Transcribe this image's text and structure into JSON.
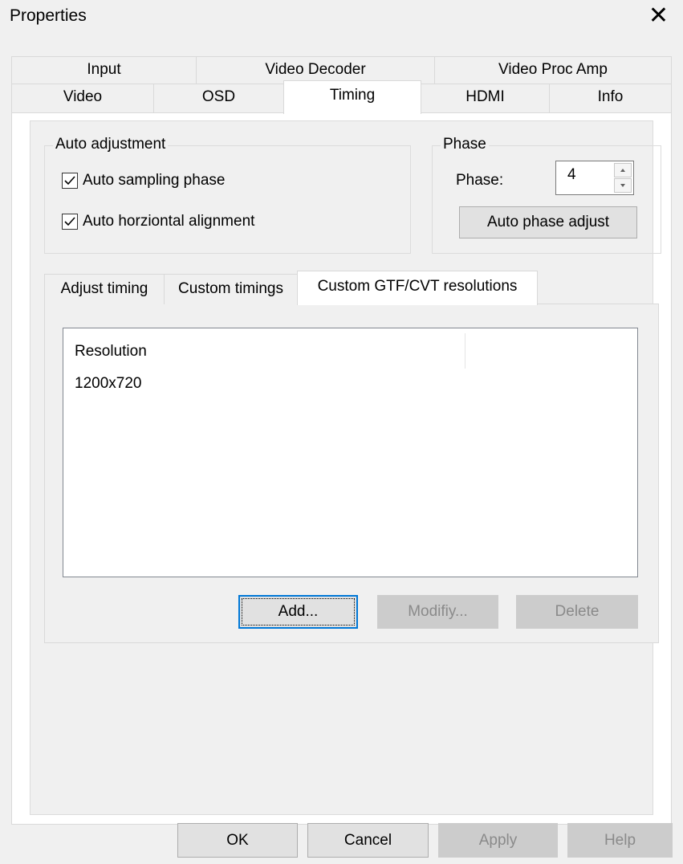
{
  "window": {
    "title": "Properties",
    "close_label": "✕"
  },
  "tabs": {
    "row1": [
      "Input",
      "Video Decoder",
      "Video Proc Amp"
    ],
    "row2": [
      "Video",
      "OSD",
      "Timing",
      "HDMI",
      "Info"
    ],
    "active": "Timing"
  },
  "auto_adjustment": {
    "title": "Auto adjustment",
    "sampling_label": "Auto sampling phase",
    "sampling_checked": true,
    "alignment_label": "Auto horziontal alignment",
    "alignment_checked": true
  },
  "phase": {
    "title": "Phase",
    "label": "Phase:",
    "value": "4",
    "auto_button": "Auto phase adjust"
  },
  "subtabs": {
    "items": [
      "Adjust timing",
      "Custom timings",
      "Custom GTF/CVT resolutions"
    ],
    "active": "Custom GTF/CVT resolutions"
  },
  "resolutions": {
    "column_header": "Resolution",
    "rows": [
      "1200x720"
    ]
  },
  "list_buttons": {
    "add": "Add...",
    "modify": "Modifiy...",
    "delete": "Delete"
  },
  "dialog_buttons": {
    "ok": "OK",
    "cancel": "Cancel",
    "apply": "Apply",
    "help": "Help"
  },
  "icons": {
    "close": "close-icon",
    "checkmark": "checkmark-icon",
    "spin_up": "spin-up-icon",
    "spin_down": "spin-down-icon"
  }
}
